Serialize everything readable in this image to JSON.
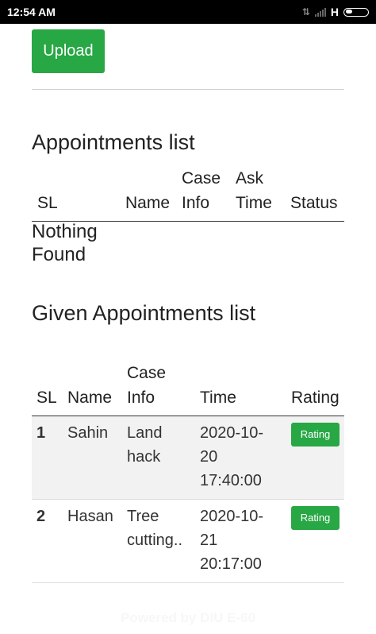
{
  "statusbar": {
    "time": "12:54 AM",
    "network": "H"
  },
  "upload_label": "Upload",
  "appointments": {
    "title": "Appointments list",
    "columns": [
      "SL",
      "Name",
      "Case Info",
      "Ask Time",
      "Status"
    ],
    "empty_text": "Nothing Found"
  },
  "given": {
    "title": "Given Appointments list",
    "columns": [
      "SL",
      "Name",
      "Case Info",
      "Time",
      "Rating"
    ],
    "rows": [
      {
        "sl": "1",
        "name": "Sahin",
        "case": "Land hack",
        "time": "2020-10-20 17:40:00",
        "action": "Rating"
      },
      {
        "sl": "2",
        "name": "Hasan",
        "case": "Tree cutting..",
        "time": "2020-10-21 20:17:00",
        "action": "Rating"
      }
    ]
  },
  "footer": "Powered by DIU E-60"
}
